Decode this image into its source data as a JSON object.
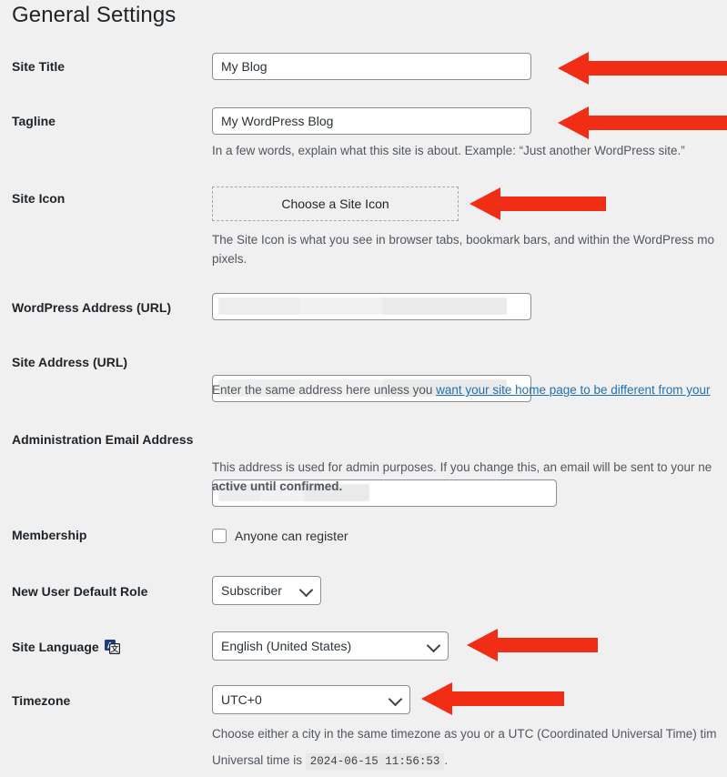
{
  "page": {
    "title": "General Settings",
    "accent_red": "#f22d16",
    "background": "#f0f0f1",
    "link_color": "#2271b1"
  },
  "fields": {
    "site_title": {
      "label": "Site Title",
      "value": "My Blog"
    },
    "tagline": {
      "label": "Tagline",
      "value": "My WordPress Blog",
      "description": "In a few words, explain what this site is about. Example: “Just another WordPress site.”"
    },
    "site_icon": {
      "label": "Site Icon",
      "button_label": "Choose a Site Icon",
      "description": "The Site Icon is what you see in browser tabs, bookmark bars, and within the WordPress mo",
      "description_line2": "pixels."
    },
    "wordpress_address": {
      "label": "WordPress Address (URL)",
      "value": ""
    },
    "site_address": {
      "label": "Site Address (URL)",
      "value": "",
      "description_prefix": "Enter the same address here unless you ",
      "description_link": "want your site home page to be different from your",
      "description_suffix": ""
    },
    "admin_email": {
      "label": "Administration Email Address",
      "value": "",
      "description_line1": "This address is used for admin purposes. If you change this, an email will be sent to your ne",
      "description_line2": "active until confirmed."
    },
    "membership": {
      "label": "Membership",
      "checkbox_label": "Anyone can register",
      "checked": false
    },
    "new_user_role": {
      "label": "New User Default Role",
      "value": "Subscriber"
    },
    "site_language": {
      "label": "Site Language",
      "icon": "translate-icon",
      "value": "English (United States)"
    },
    "timezone": {
      "label": "Timezone",
      "value": "UTC+0",
      "description": "Choose either a city in the same timezone as you or a UTC (Coordinated Universal Time) tim",
      "universal_time_prefix": "Universal time is",
      "universal_time_value": "2024-06-15 11:56:53",
      "universal_time_suffix": "."
    }
  },
  "annotations": {
    "arrows": [
      {
        "name": "arrow-site-title",
        "target": "Site Title"
      },
      {
        "name": "arrow-tagline",
        "target": "Tagline"
      },
      {
        "name": "arrow-site-icon",
        "target": "Site Icon"
      },
      {
        "name": "arrow-site-language",
        "target": "Site Language"
      },
      {
        "name": "arrow-timezone",
        "target": "Timezone"
      }
    ]
  }
}
